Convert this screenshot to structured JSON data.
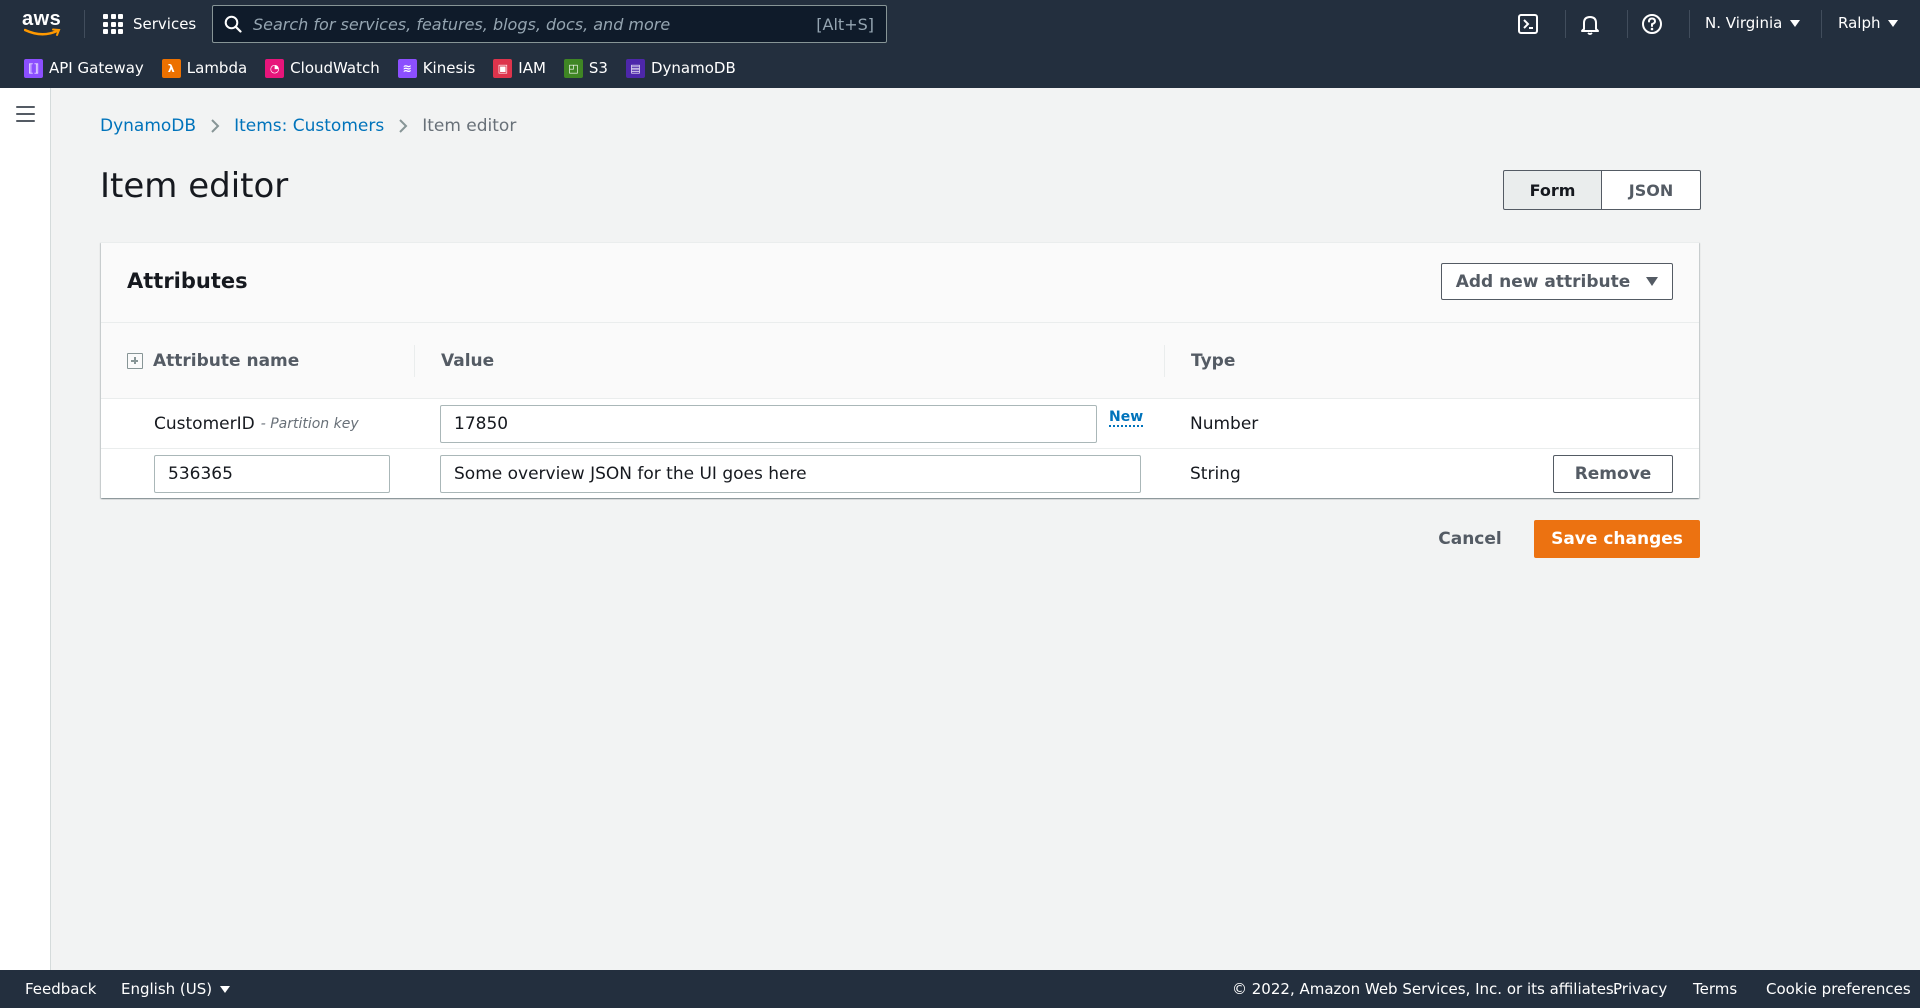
{
  "nav": {
    "logo_text": "aws",
    "services_label": "Services",
    "search_placeholder": "Search for services, features, blogs, docs, and more",
    "search_shortcut": "[Alt+S]",
    "region_label": "N. Virginia",
    "user_label": "Ralph",
    "icons": [
      "cloudshell-icon",
      "bell-icon",
      "help-icon"
    ]
  },
  "favorites": [
    {
      "label": "API Gateway",
      "color": "#8c4fff",
      "icon": "api-gateway-icon"
    },
    {
      "label": "Lambda",
      "color": "#ed7100",
      "icon": "lambda-icon"
    },
    {
      "label": "CloudWatch",
      "color": "#e7157b",
      "icon": "cloudwatch-icon"
    },
    {
      "label": "Kinesis",
      "color": "#8c4fff",
      "icon": "kinesis-icon"
    },
    {
      "label": "IAM",
      "color": "#dd344c",
      "icon": "iam-icon"
    },
    {
      "label": "S3",
      "color": "#3f8624",
      "icon": "s3-icon"
    },
    {
      "label": "DynamoDB",
      "color": "#4d27aa",
      "icon": "dynamodb-icon"
    }
  ],
  "breadcrumb": {
    "items": [
      "DynamoDB",
      "Items: Customers"
    ],
    "current": "Item editor"
  },
  "page": {
    "title": "Item editor",
    "view_toggle": {
      "form": "Form",
      "json": "JSON",
      "selected": "Form"
    }
  },
  "attributes": {
    "title": "Attributes",
    "add_button": "Add new attribute",
    "columns": {
      "name": "Attribute name",
      "value": "Value",
      "type": "Type"
    },
    "rows": [
      {
        "name": "CustomerID",
        "note": "- Partition key",
        "value": "17850",
        "badge": "New",
        "type": "Number"
      },
      {
        "name": "536365",
        "value": "Some overview JSON for the UI goes here",
        "type": "String",
        "action": "Remove"
      }
    ]
  },
  "actions": {
    "cancel": "Cancel",
    "save": "Save changes"
  },
  "footer": {
    "feedback": "Feedback",
    "language": "English (US)",
    "copyright": "© 2022, Amazon Web Services, Inc. or its affiliates.",
    "privacy": "Privacy",
    "terms": "Terms",
    "cookies": "Cookie preferences"
  },
  "colors": {
    "nav_bg": "#232f3e",
    "link": "#0073bb",
    "primary": "#ec7211"
  }
}
